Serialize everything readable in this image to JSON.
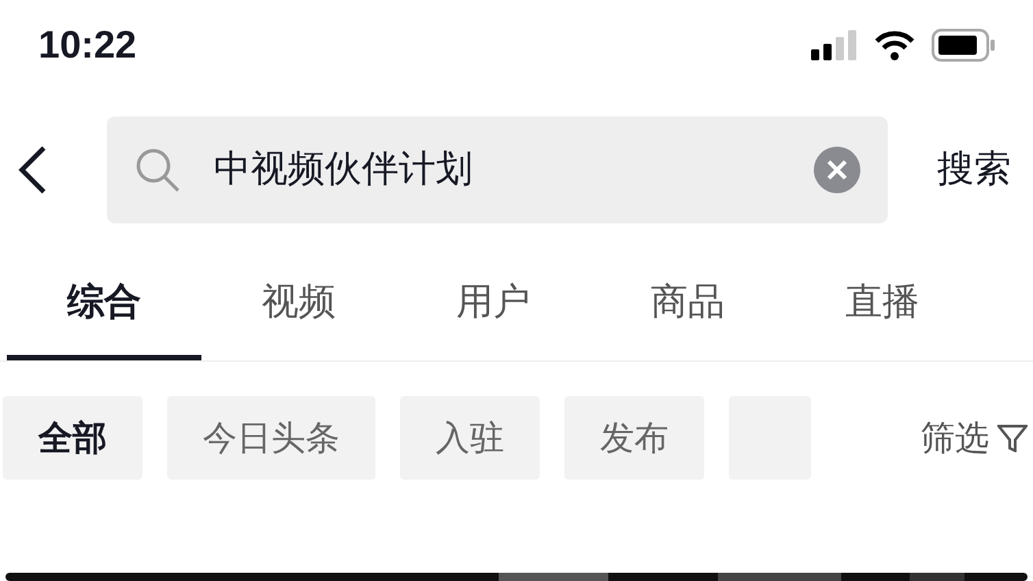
{
  "status_bar": {
    "time": "10:22"
  },
  "search": {
    "value": "中视频伙伴计划",
    "action": "搜索"
  },
  "tabs": [
    {
      "label": "综合",
      "selected": true
    },
    {
      "label": "视频",
      "selected": false
    },
    {
      "label": "用户",
      "selected": false
    },
    {
      "label": "商品",
      "selected": false
    },
    {
      "label": "直播",
      "selected": false
    }
  ],
  "chips": [
    {
      "label": "全部",
      "selected": true
    },
    {
      "label": "今日头条",
      "selected": false
    },
    {
      "label": "入驻",
      "selected": false
    },
    {
      "label": "发布",
      "selected": false
    }
  ],
  "filter": {
    "label": "筛选"
  }
}
